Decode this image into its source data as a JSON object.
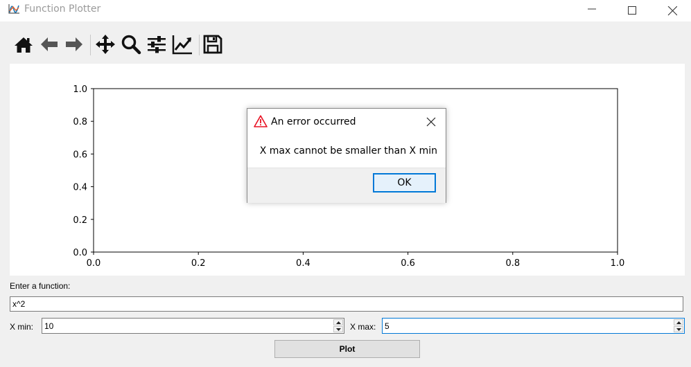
{
  "window": {
    "title": "Function Plotter",
    "icon": "plot-icon",
    "controls": [
      "minimize-icon",
      "maximize-icon",
      "close-icon"
    ]
  },
  "toolbar": {
    "items": [
      {
        "name": "home",
        "icon": "home-icon"
      },
      {
        "name": "back",
        "icon": "arrow-left-icon"
      },
      {
        "name": "forward",
        "icon": "arrow-right-icon"
      },
      {
        "name": "pan",
        "icon": "move-icon"
      },
      {
        "name": "zoom",
        "icon": "zoom-icon"
      },
      {
        "name": "configure-subplots",
        "icon": "sliders-icon"
      },
      {
        "name": "edit-curves",
        "icon": "line-chart-icon"
      },
      {
        "name": "save",
        "icon": "floppy-disk-icon"
      }
    ]
  },
  "chart_data": {
    "type": "line",
    "series": [],
    "xlim": [
      0.0,
      1.0
    ],
    "ylim": [
      0.0,
      1.0
    ],
    "x_ticks": [
      "0.0",
      "0.2",
      "0.4",
      "0.6",
      "0.8",
      "1.0"
    ],
    "y_ticks": [
      "0.0",
      "0.2",
      "0.4",
      "0.6",
      "0.8",
      "1.0"
    ],
    "grid": false
  },
  "form": {
    "function_label": "Enter a function:",
    "function_value": "x^2",
    "xmin_label": "X min:",
    "xmin_value": "10",
    "xmax_label": "X max:",
    "xmax_value": "5",
    "plot_button": "Plot"
  },
  "dialog": {
    "title": "An error occurred",
    "icon": "warning-icon",
    "message": "X max cannot be smaller than X min",
    "ok_button": "OK"
  },
  "colors": {
    "accent": "#0078d7",
    "warning": "#e81123"
  }
}
